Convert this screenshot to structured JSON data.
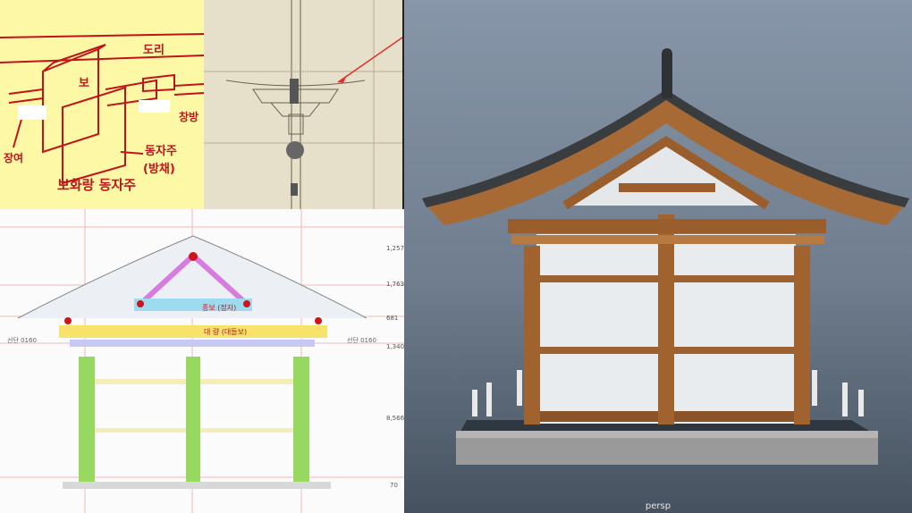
{
  "sketch": {
    "labels": [
      "도리",
      "보",
      "창방",
      "장여",
      "장여",
      "동자주",
      "(방채)",
      "보화랑 동자주"
    ]
  },
  "elevation": {
    "dimensions": [
      "1,257",
      "1,763",
      "681",
      "1,340",
      "8,566",
      "70"
    ],
    "side_labels": [
      "선단 0160",
      "선단 0160"
    ],
    "member_labels": [
      "종보 (정자)",
      "대 량 (대들보)"
    ]
  },
  "viewport": {
    "camera": "persp"
  },
  "colors": {
    "sketch_bg": "#fdf8a6",
    "ink_red": "#c0141b",
    "viewport_bg": "#7a8899",
    "timber": "#a0632f",
    "roof_tile": "#3a3d40",
    "wall": "#e9ecee"
  }
}
